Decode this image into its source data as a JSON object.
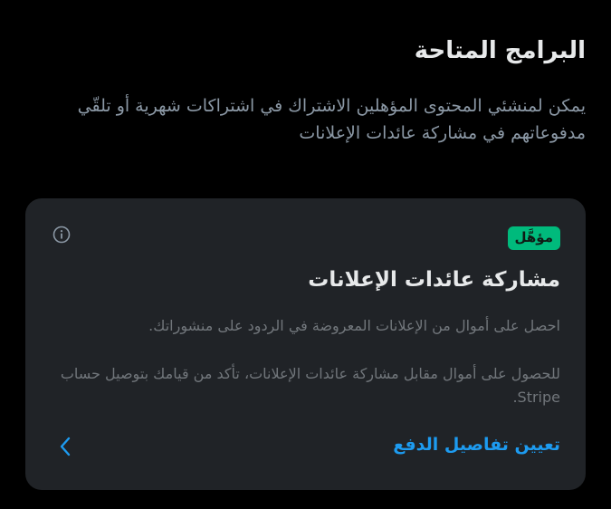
{
  "section": {
    "title": "البرامج المتاحة",
    "description": "يمكن لمنشئي المحتوى المؤهلين الاشتراك في اشتراكات شهرية أو تلقّي مدفوعاتهم في مشاركة عائدات الإعلانات"
  },
  "card": {
    "badge": "مؤهَّل",
    "title": "مشاركة عائدات الإعلانات",
    "text_1": "احصل على أموال من الإعلانات المعروضة في الردود على منشوراتك.",
    "text_2": "للحصول على أموال مقابل مشاركة عائدات الإعلانات، تأكد من قيامك بتوصيل حساب Stripe.",
    "action_label": "تعيين تفاصيل الدفع",
    "info_icon": "info-icon",
    "chevron_icon": "chevron-left-icon"
  },
  "colors": {
    "background": "#000000",
    "card": "#202327",
    "accent": "#1d9bf0",
    "badge": "#00ba7c",
    "primary_text": "#e7e9ea",
    "secondary_text": "#8b98a5"
  }
}
